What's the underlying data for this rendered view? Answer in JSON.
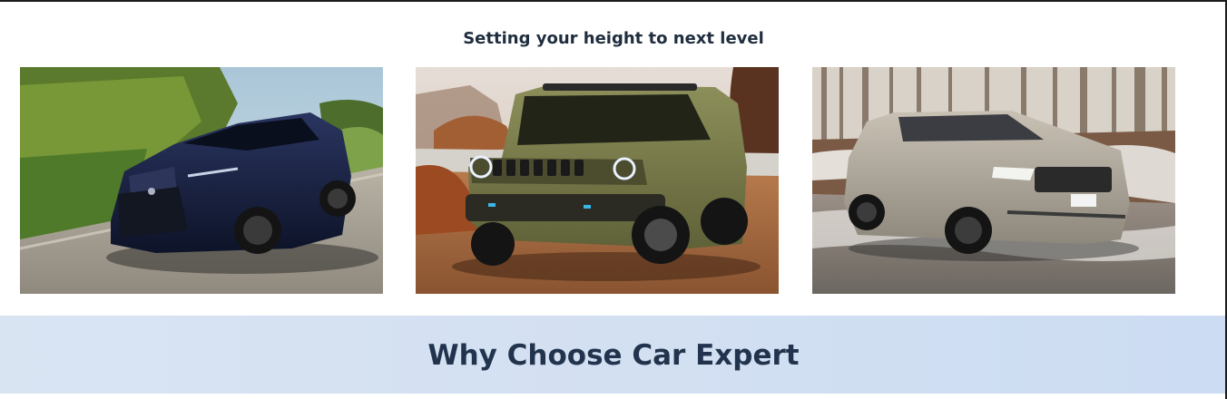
{
  "hero": {
    "subtitle": "Setting your height to next level"
  },
  "cars": [
    {
      "icon": "lexus-suv-photo",
      "body_color": "#141d3a"
    },
    {
      "icon": "jeep-suv-photo",
      "body_color": "#7b7d4e"
    },
    {
      "icon": "range-rover-photo",
      "body_color": "#b9b1a3"
    }
  ],
  "why": {
    "title": "Why Choose Car Expert"
  },
  "colors": {
    "heading": "#1f2d3d",
    "section_bg": "#d3e0f2",
    "section_title": "#22344d"
  }
}
